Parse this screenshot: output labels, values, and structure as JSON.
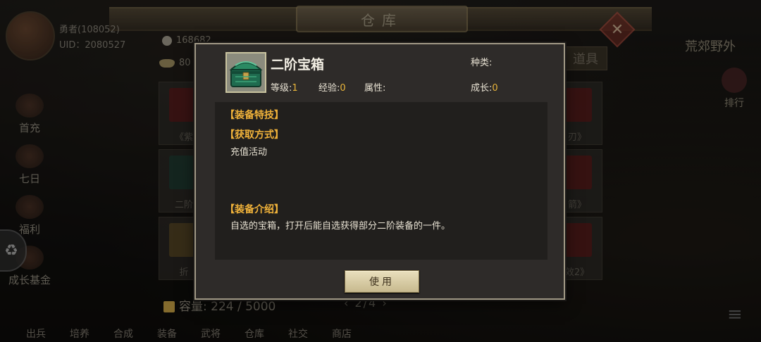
{
  "background": {
    "title": "仓库",
    "player_name": "勇者(108052)",
    "uid": "UID：2080527",
    "coin": "168682",
    "ingot": "80",
    "tab": "道具",
    "left_menu": [
      "首充",
      "七日",
      "福利",
      "成长基金"
    ],
    "region": "荒郊野外",
    "rank": "排行",
    "grid_captions": [
      "《紫",
      "二阶",
      "折",
      "刃》",
      "箭》",
      "效2》"
    ],
    "capacity": "容量: 224 / 5000",
    "pager": "2/4",
    "bottom_menu": [
      "出兵",
      "培养",
      "合成",
      "装备",
      "武将",
      "仓库",
      "社交",
      "商店"
    ]
  },
  "item": {
    "name": "二阶宝箱",
    "level_label": "等级:",
    "level_value": "1",
    "exp_label": "经验:",
    "exp_value": "0",
    "attr_label": "属性:",
    "kind_label": "种类:",
    "growth_label": "成长:",
    "growth_value": "0",
    "icon": "green-treasure-chest-icon"
  },
  "details": {
    "skill_title": "【装备特技】",
    "source_title": "【获取方式】",
    "source_text": "充值活动",
    "intro_title": "【装备介绍】",
    "intro_text": "自选的宝箱，打开后能自选获得部分二阶装备的一件。"
  },
  "actions": {
    "use_label": "使用"
  },
  "colors": {
    "accent_gold": "#f0b23a",
    "value_gold": "#e9b53a",
    "modal_bg": "#2e2b29",
    "panel_bg": "#211f1d"
  }
}
